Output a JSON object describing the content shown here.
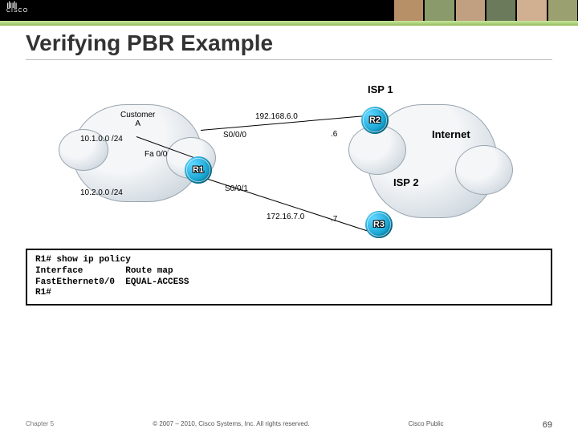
{
  "header": {
    "brand": "CISCO"
  },
  "title": "Verifying PBR Example",
  "diagram": {
    "customer_label": "Customer\nA",
    "internet_label": "Internet",
    "isp1_label": "ISP 1",
    "isp2_label": "ISP 2",
    "nets": {
      "net1": "10.1.0.0 /24",
      "net2": "10.2.0.0 /24",
      "seg_up": "192.168.6.0",
      "seg_dn": "172.16.7.0",
      "host_up": ".6",
      "host_dn": ".7",
      "fa": "Fa 0/0",
      "s00": "S0/0/0",
      "s01": "S0/0/1"
    },
    "routers": {
      "r1": "R1",
      "r2": "R2",
      "r3": "R3"
    }
  },
  "cli": "R1# show ip policy\nInterface        Route map\nFastEthernet0/0  EQUAL-ACCESS\nR1#",
  "footer": {
    "chapter": "Chapter 5",
    "copyright": "© 2007 – 2010, Cisco Systems, Inc. All rights reserved.",
    "public": "Cisco Public",
    "page": "69"
  }
}
